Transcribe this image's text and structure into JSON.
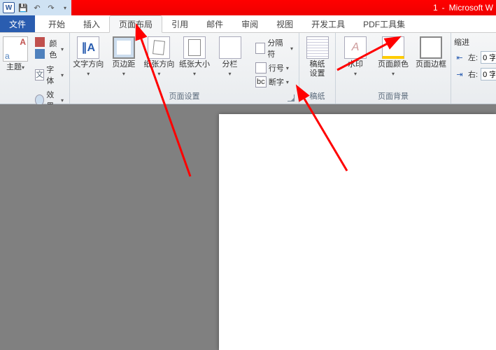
{
  "titlebar": {
    "doc": "1",
    "app": "Microsoft W"
  },
  "tabs": {
    "file": "文件",
    "items": [
      "开始",
      "插入",
      "页面布局",
      "引用",
      "邮件",
      "审阅",
      "视图",
      "开发工具",
      "PDF工具集"
    ],
    "active_index": 2
  },
  "groups": {
    "themes": {
      "label": "主题",
      "main": "主题",
      "colors": "颜色",
      "fonts": "字体",
      "effects": "效果"
    },
    "page_setup": {
      "label": "页面设置",
      "text_dir": "文字方向",
      "margins": "页边距",
      "orientation": "纸张方向",
      "size": "纸张大小",
      "columns": "分栏",
      "breaks": "分隔符",
      "line_num": "行号",
      "hyphen": "断字"
    },
    "manuscript": {
      "label": "稿纸",
      "settings_l1": "稿纸",
      "settings_l2": "设置"
    },
    "background": {
      "label": "页面背景",
      "watermark": "水印",
      "color": "页面颜色",
      "border": "页面边框"
    },
    "indent": {
      "header": "缩进",
      "left": "左:",
      "right": "右:",
      "left_val": "0 字",
      "right_val": "0 字"
    }
  }
}
